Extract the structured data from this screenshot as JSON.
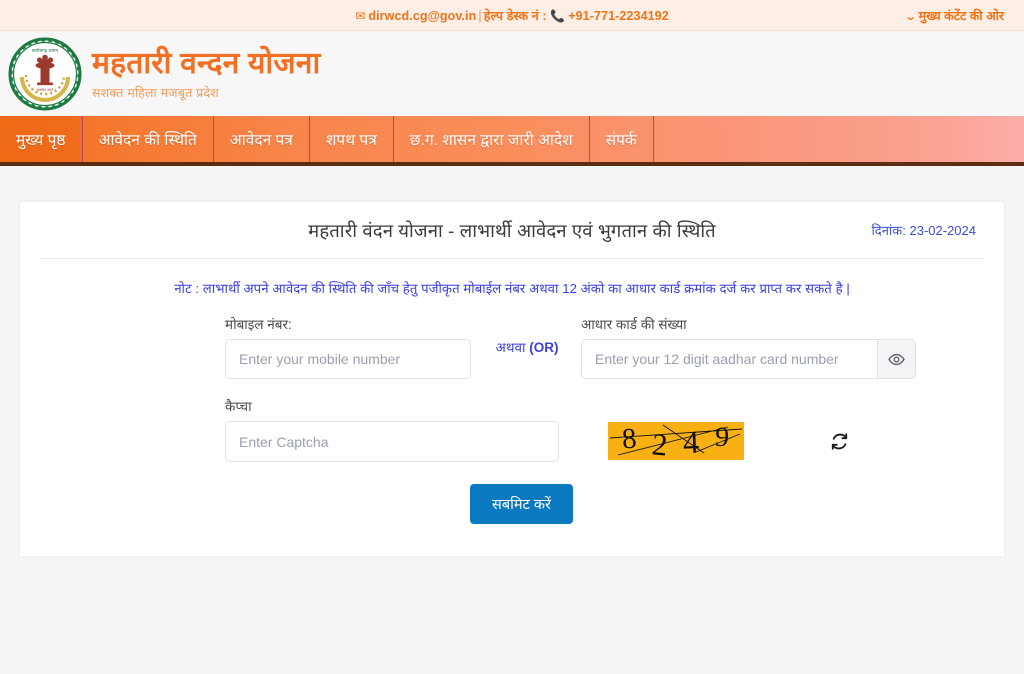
{
  "topbar": {
    "email": "dirwcd.cg@gov.in",
    "separator": "|",
    "helpdesk_label": "हेल्प डेस्क नं :",
    "phone": "+91-771-2234192",
    "skip_link": "मुख्य कंटेंट की ओर",
    "mail_icon": "mail-icon",
    "phone_icon": "phone-icon",
    "chevron_icon": "chevron-down-icon",
    "bg_color": "#fdeee6",
    "text_color": "#f47216"
  },
  "masthead": {
    "emblem_alt": "chhattisgarh-government-emblem",
    "title": "महतारी वन्दन योजना",
    "subtitle": "सशक्त महिला मजबूत प्रदेश",
    "title_color": "#f36f21",
    "subtitle_color": "#f59a5a"
  },
  "nav": {
    "items": [
      {
        "label": "मुख्य पृष्ठ",
        "active": true
      },
      {
        "label": "आवेदन की स्थिति",
        "active": false
      },
      {
        "label": "आवेदन पत्र",
        "active": false
      },
      {
        "label": "शपथ पत्र",
        "active": false
      },
      {
        "label": "छ.ग. शासन द्वारा जारी आदेश",
        "active": false
      },
      {
        "label": "संपर्क",
        "active": false
      }
    ],
    "gradient_from": "#f4701e",
    "gradient_to": "#fcaeaa",
    "underline_color": "#5b2d12"
  },
  "card": {
    "title": "महतारी वंदन योजना - लाभार्थी आवेदन एवं भुगतान की स्थिति",
    "date_label": "दिनांक: 23-02-2024",
    "date_color": "#3b4fd8",
    "note": "नोट : लाभार्थी अपने आवेदन की स्थिति की जाँच हेतु पजीकृत मोबाईल नंबर अथवा 12 अंको का आधार कार्ड क्रमांक दर्ज कर प्राप्त कर सकते है |",
    "note_color": "#3b3fe0"
  },
  "form": {
    "mobile": {
      "label": "मोबाइल नंबर:",
      "placeholder": "Enter your mobile number",
      "value": ""
    },
    "or_text_hindi": "अथवा ",
    "or_text_en": "(OR)",
    "aadhar": {
      "label": "आधार कार्ड की संख्या",
      "placeholder": "Enter your 12 digit aadhar card number",
      "value": "",
      "toggle_icon": "eye-icon"
    },
    "captcha": {
      "label": "कैप्चा",
      "placeholder": "Enter Captcha",
      "value": "",
      "code": "8249",
      "digits": [
        "8",
        "2",
        "4",
        "9"
      ],
      "bg_color": "#f8b012",
      "refresh_icon": "refresh-icon"
    },
    "submit_label": "सबमिट करें",
    "submit_color": "#0b79c0"
  }
}
